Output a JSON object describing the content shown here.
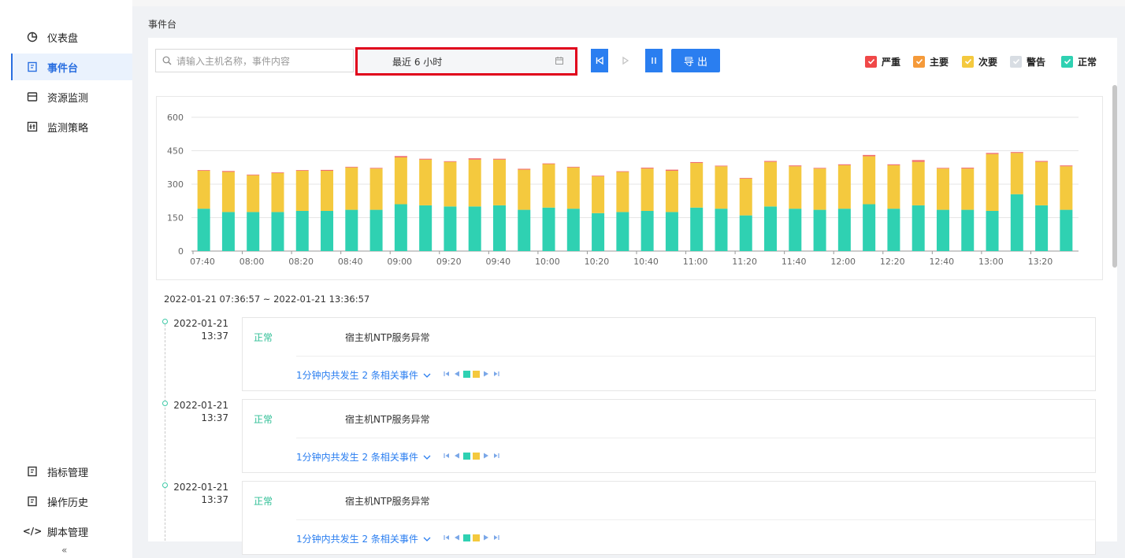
{
  "sidebar": {
    "top_items": [
      {
        "label": "仪表盘",
        "icon": "pie-chart-icon"
      },
      {
        "label": "事件台",
        "icon": "event-doc-icon"
      },
      {
        "label": "资源监测",
        "icon": "monitor-icon"
      },
      {
        "label": "监测策略",
        "icon": "policy-icon"
      }
    ],
    "bottom_items": [
      {
        "label": "指标管理",
        "icon": "doc-icon"
      },
      {
        "label": "操作历史",
        "icon": "doc-icon"
      },
      {
        "label": "脚本管理",
        "icon": "code-icon"
      }
    ],
    "collapse_label": "«"
  },
  "page": {
    "title": "事件台"
  },
  "toolbar": {
    "search_placeholder": "请输入主机名称，事件内容",
    "time_range": "最近 6 小时",
    "export_label": "导 出"
  },
  "legend": [
    {
      "label": "严重",
      "color": "#f04848",
      "checked": true
    },
    {
      "label": "主要",
      "color": "#f59a3a",
      "checked": true
    },
    {
      "label": "次要",
      "color": "#f4c93e",
      "checked": true
    },
    {
      "label": "警告",
      "color": "#d8dde3",
      "checked": true
    },
    {
      "label": "正常",
      "color": "#2fd1b2",
      "checked": true
    }
  ],
  "chart_data": {
    "type": "bar",
    "stacked": true,
    "ylim": [
      0,
      600
    ],
    "yticks": [
      0,
      150,
      300,
      450,
      600
    ],
    "xticks": [
      "07:40",
      "08:00",
      "08:20",
      "08:40",
      "09:00",
      "09:20",
      "09:40",
      "10:00",
      "10:20",
      "10:40",
      "11:00",
      "11:20",
      "11:40",
      "12:00",
      "12:20",
      "12:40",
      "13:00",
      "13:20"
    ],
    "colors": {
      "normal": "#2fd1b2",
      "minor": "#f4c93e",
      "critical": "#f06e6e"
    },
    "series": [
      {
        "name": "正常",
        "values": [
          190,
          175,
          175,
          175,
          180,
          180,
          185,
          185,
          210,
          205,
          200,
          200,
          205,
          185,
          195,
          190,
          170,
          175,
          180,
          175,
          195,
          190,
          160,
          200,
          190,
          185,
          190,
          210,
          190,
          205,
          185,
          185,
          180,
          255,
          205,
          185
        ]
      },
      {
        "name": "次要",
        "values": [
          170,
          180,
          165,
          175,
          180,
          180,
          190,
          185,
          210,
          205,
          200,
          210,
          205,
          180,
          195,
          185,
          165,
          180,
          190,
          185,
          200,
          190,
          165,
          200,
          190,
          185,
          195,
          215,
          195,
          195,
          185,
          185,
          255,
          185,
          195,
          195
        ]
      },
      {
        "name": "严重",
        "values": [
          3,
          4,
          3,
          3,
          3,
          4,
          3,
          3,
          6,
          4,
          3,
          6,
          4,
          4,
          3,
          3,
          3,
          3,
          4,
          5,
          4,
          3,
          3,
          4,
          4,
          3,
          4,
          6,
          4,
          8,
          3,
          4,
          5,
          4,
          4,
          4
        ]
      }
    ]
  },
  "range_text": "2022-01-21 07:36:57 ~ 2022-01-21 13:36:57",
  "events": [
    {
      "date": "2022-01-21",
      "time": "13:37",
      "status": "正常",
      "name": "宿主机NTP服务异常",
      "related": "1分钟内共发生 2 条相关事件"
    },
    {
      "date": "2022-01-21",
      "time": "13:37",
      "status": "正常",
      "name": "宿主机NTP服务异常",
      "related": "1分钟内共发生 2 条相关事件"
    },
    {
      "date": "2022-01-21",
      "time": "13:37",
      "status": "正常",
      "name": "宿主机NTP服务异常",
      "related": "1分钟内共发生 2 条相关事件"
    }
  ]
}
